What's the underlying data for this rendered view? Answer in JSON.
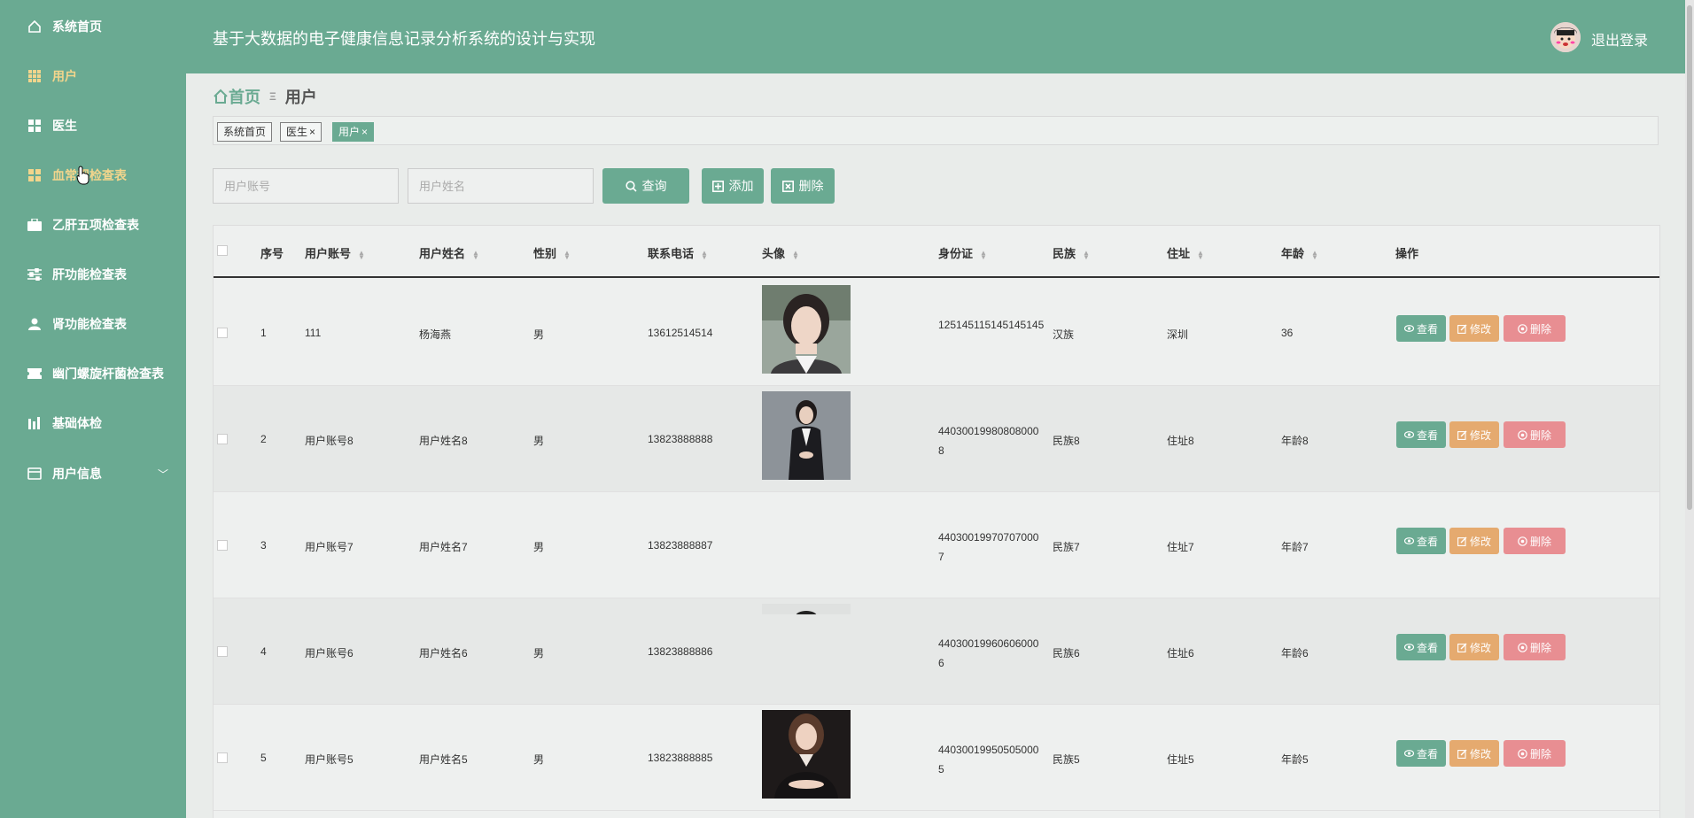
{
  "sidebar": {
    "items": [
      {
        "label": "系统首页",
        "icon": "home-icon"
      },
      {
        "label": "用户",
        "icon": "grid-icon"
      },
      {
        "label": "医生",
        "icon": "apps-icon"
      },
      {
        "label": "血常规检查表",
        "icon": "apps-icon"
      },
      {
        "label": "乙肝五项检查表",
        "icon": "briefcase-icon"
      },
      {
        "label": "肝功能检查表",
        "icon": "sliders-icon"
      },
      {
        "label": "肾功能检查表",
        "icon": "user-icon"
      },
      {
        "label": "幽门螺旋杆菌检查表",
        "icon": "ticket-icon"
      },
      {
        "label": "基础体检",
        "icon": "chart-icon"
      },
      {
        "label": "用户信息",
        "icon": "card-icon"
      }
    ]
  },
  "header": {
    "title": "基于大数据的电子健康信息记录分析系统的设计与实现",
    "logout": "退出登录"
  },
  "breadcrumb": {
    "home": "首页",
    "sep": "Ξ",
    "current": "用户"
  },
  "tags": [
    {
      "label": "系统首页",
      "close": ""
    },
    {
      "label": "医生",
      "close": "×"
    },
    {
      "label": "用户",
      "close": "×"
    }
  ],
  "search": {
    "account_placeholder": "用户账号",
    "name_placeholder": "用户姓名",
    "query": "查询",
    "add": "添加",
    "delete": "删除"
  },
  "table": {
    "headers": [
      "序号",
      "用户账号",
      "用户姓名",
      "性别",
      "联系电话",
      "头像",
      "身份证",
      "民族",
      "住址",
      "年龄",
      "操作"
    ],
    "rows": [
      {
        "no": "1",
        "account": "111",
        "name": "杨海燕",
        "gender": "男",
        "phone": "13612514514",
        "idcard": "125145115145145145",
        "nation": "汉族",
        "addr": "深圳",
        "age": "36",
        "photo": "girl"
      },
      {
        "no": "2",
        "account": "用户账号8",
        "name": "用户姓名8",
        "gender": "男",
        "phone": "13823888888",
        "idcard": "440300199808080008",
        "nation": "民族8",
        "addr": "住址8",
        "age": "年龄8",
        "photo": "suit"
      },
      {
        "no": "3",
        "account": "用户账号7",
        "name": "用户姓名7",
        "gender": "男",
        "phone": "13823888887",
        "idcard": "440300199707070007",
        "nation": "民族7",
        "addr": "住址7",
        "age": "年龄7",
        "photo": "none"
      },
      {
        "no": "4",
        "account": "用户账号6",
        "name": "用户姓名6",
        "gender": "男",
        "phone": "13823888886",
        "idcard": "440300199606060006",
        "nation": "民族6",
        "addr": "住址6",
        "age": "年龄6",
        "photo": "partial"
      },
      {
        "no": "5",
        "account": "用户账号5",
        "name": "用户姓名5",
        "gender": "男",
        "phone": "13823888885",
        "idcard": "440300199505050005",
        "nation": "民族5",
        "addr": "住址5",
        "age": "年龄5",
        "photo": "dark"
      }
    ],
    "actions": {
      "view": "查看",
      "edit": "修改",
      "delete": "删除"
    }
  },
  "colors": {
    "primary": "#6aaa92",
    "warning": "#e5aa6f",
    "danger": "#e88e92",
    "active_menu": "#f2d58c"
  }
}
